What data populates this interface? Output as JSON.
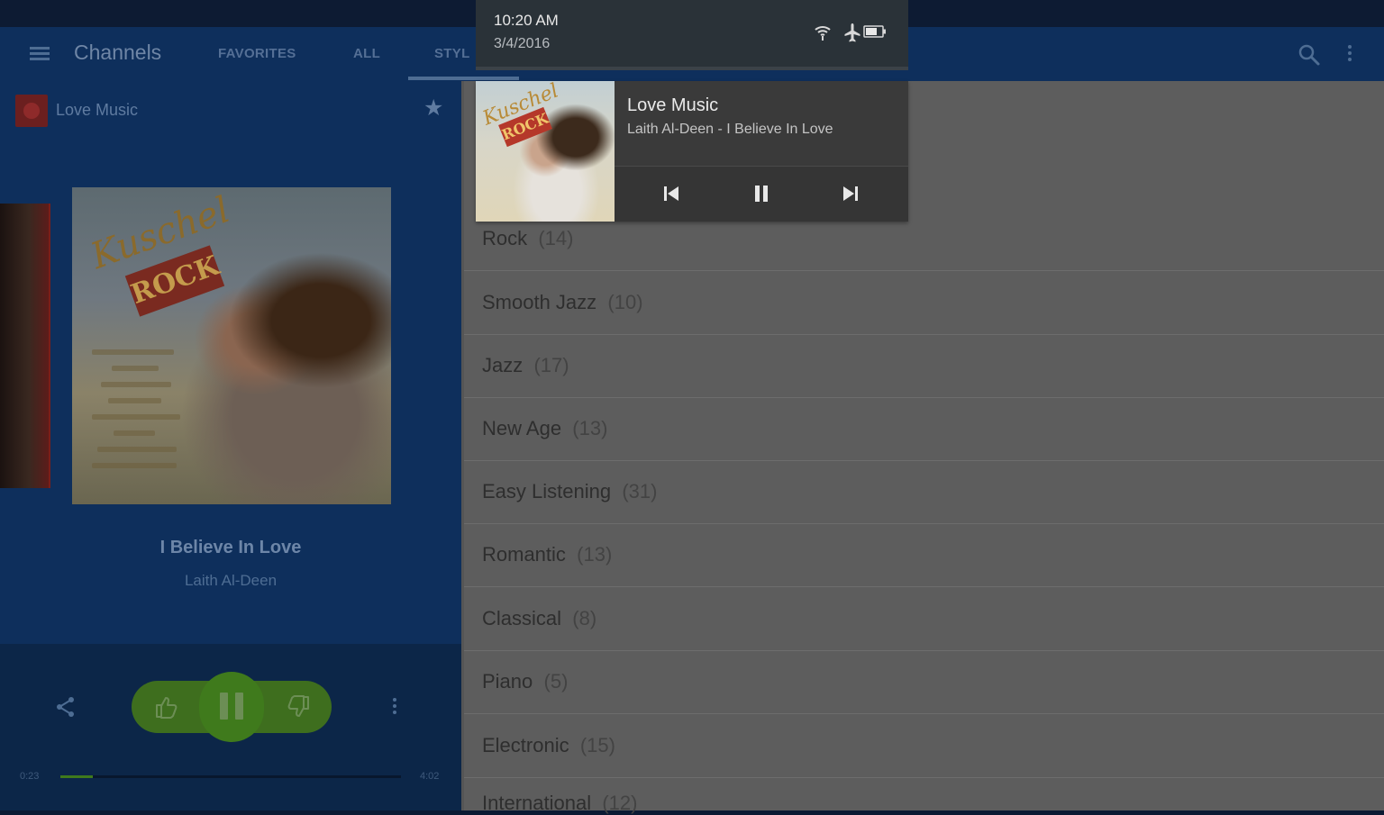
{
  "status": {
    "time": "10:20 AM",
    "date": "3/4/2016",
    "icons": [
      "wifi-icon",
      "airplane-icon",
      "battery-icon"
    ]
  },
  "appbar": {
    "title": "Channels",
    "tabs": [
      {
        "label": "FAVORITES",
        "active": false
      },
      {
        "label": "ALL",
        "active": false
      },
      {
        "label": "STYL",
        "active": true
      }
    ],
    "icons": [
      "menu-icon",
      "search-icon",
      "overflow-icon"
    ]
  },
  "player": {
    "station": "Love Music",
    "song_title": "I Believe In Love",
    "artist": "Laith Al-Deen",
    "elapsed": "0:23",
    "duration": "4:02",
    "progress_fraction": 0.095,
    "accent": "#3f7a1c"
  },
  "notification": {
    "title": "Love Music",
    "subtitle": "Laith Al-Deen - I Believe In Love"
  },
  "styles": [
    {
      "name": "Rock",
      "count": "(14)"
    },
    {
      "name": "Smooth Jazz",
      "count": "(10)"
    },
    {
      "name": "Jazz",
      "count": "(17)"
    },
    {
      "name": "New Age",
      "count": "(13)"
    },
    {
      "name": "Easy Listening",
      "count": "(31)"
    },
    {
      "name": "Romantic",
      "count": "(13)"
    },
    {
      "name": "Classical",
      "count": "(8)"
    },
    {
      "name": "Piano",
      "count": "(5)"
    },
    {
      "name": "Electronic",
      "count": "(15)"
    },
    {
      "name": "International",
      "count": "(12)"
    }
  ]
}
